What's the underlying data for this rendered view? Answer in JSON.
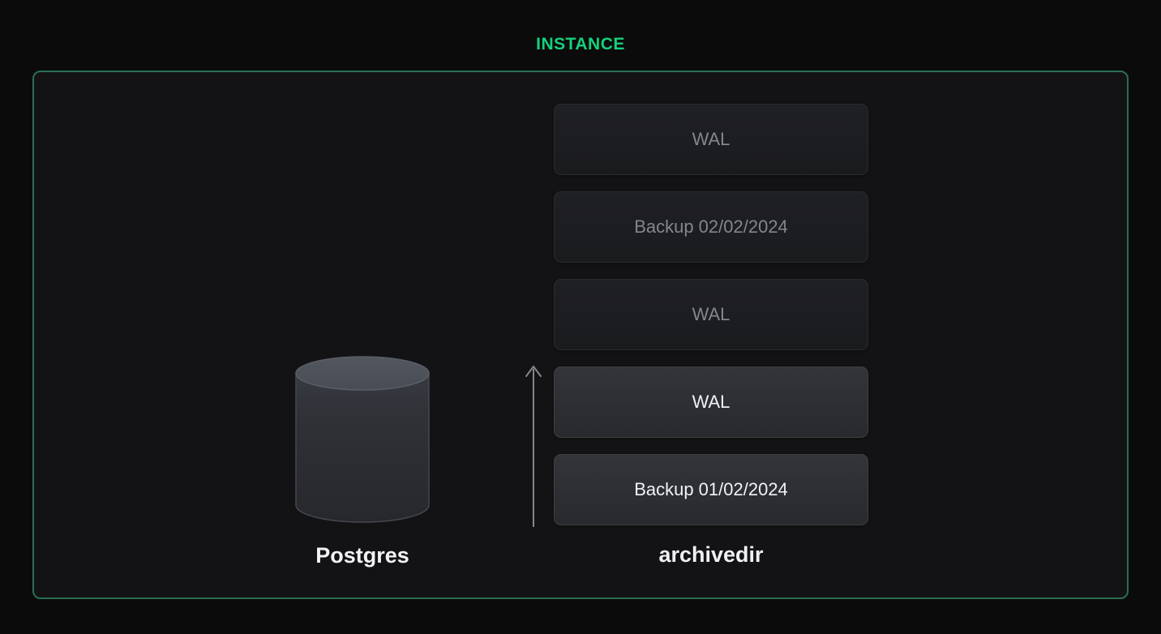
{
  "title": "INSTANCE",
  "colors": {
    "title_green": "#15d07c",
    "panel_border_green": "#2b6e52",
    "outer_background": "#0b0b0c",
    "panel_background": "#131315",
    "dimmed_text": "#83868c",
    "active_text": "#f0f2f4"
  },
  "postgres": {
    "label": "Postgres",
    "icon": "database-cylinder-icon"
  },
  "arrow": {
    "direction": "up",
    "icon": "arrow-up-icon"
  },
  "archive": {
    "label": "archivedir",
    "boxes": [
      {
        "label": "WAL",
        "state": "dimmed"
      },
      {
        "label": "Backup 02/02/2024",
        "state": "dimmed"
      },
      {
        "label": "WAL",
        "state": "dimmed"
      },
      {
        "label": "WAL",
        "state": "active"
      },
      {
        "label": "Backup 01/02/2024",
        "state": "active"
      }
    ]
  }
}
